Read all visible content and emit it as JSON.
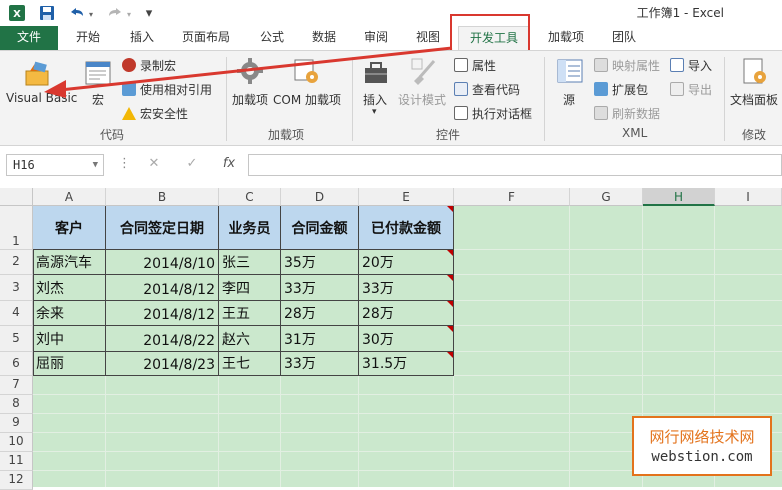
{
  "window": {
    "title": "工作簿1 - Excel"
  },
  "quick_access": {
    "undo_icon": "undo-icon",
    "redo_icon": "redo-icon",
    "save_icon": "save-icon",
    "customize_glyph": "▾"
  },
  "tabs": [
    {
      "label": "文件"
    },
    {
      "label": "开始"
    },
    {
      "label": "插入"
    },
    {
      "label": "页面布局"
    },
    {
      "label": "公式"
    },
    {
      "label": "数据"
    },
    {
      "label": "审阅"
    },
    {
      "label": "视图"
    },
    {
      "label": "开发工具"
    },
    {
      "label": "加载项"
    },
    {
      "label": "团队"
    }
  ],
  "ribbon": {
    "code": {
      "visual_basic": "Visual Basic",
      "macros": "宏",
      "record_macro": "录制宏",
      "relative_refs": "使用相对引用",
      "macro_security": "宏安全性",
      "group_label": "代码"
    },
    "addins": {
      "addins": "加载项",
      "com_addins": "COM 加载项",
      "group_label": "加载项"
    },
    "controls": {
      "insert": "插入",
      "design_mode": "设计模式",
      "properties": "属性",
      "view_code": "查看代码",
      "run_dialog": "执行对话框",
      "group_label": "控件"
    },
    "xml": {
      "source": "源",
      "map_properties": "映射属性",
      "expansion_packs": "扩展包",
      "refresh_data": "刷新数据",
      "import": "导入",
      "export": "导出",
      "group_label": "XML"
    },
    "modify": {
      "doc_panel": "文档面板",
      "group_label": "修改"
    }
  },
  "formula_bar": {
    "name_box": "H16",
    "cancel": "✕",
    "enter": "✓",
    "fx": "fx",
    "value": ""
  },
  "columns": [
    "A",
    "B",
    "C",
    "D",
    "E",
    "F",
    "G",
    "H",
    "I"
  ],
  "selected_column": "H",
  "rows": [
    "1",
    "2",
    "3",
    "4",
    "5",
    "6",
    "7",
    "8",
    "9",
    "10",
    "11",
    "12"
  ],
  "table": {
    "headers": [
      "客户",
      "合同签定日期",
      "业务员",
      "合同金额",
      "已付款金额"
    ],
    "rows": [
      [
        "高源汽车",
        "2014/8/10",
        "张三",
        "35万",
        "20万"
      ],
      [
        "刘杰",
        "2014/8/12",
        "李四",
        "33万",
        "33万"
      ],
      [
        "余来",
        "2014/8/12",
        "王五",
        "28万",
        "28万"
      ],
      [
        "刘中",
        "2014/8/22",
        "赵六",
        "31万",
        "30万"
      ],
      [
        "屈丽",
        "2014/8/23",
        "王七",
        "33万",
        "31.5万"
      ]
    ]
  },
  "watermark": {
    "line1": "网行网络技术网",
    "line2": "webstion.com"
  },
  "colors": {
    "excel_green": "#217346",
    "highlight_red": "#d9382f",
    "header_fill": "#bdd7ee",
    "sheet_bg": "#cbe8cd"
  }
}
